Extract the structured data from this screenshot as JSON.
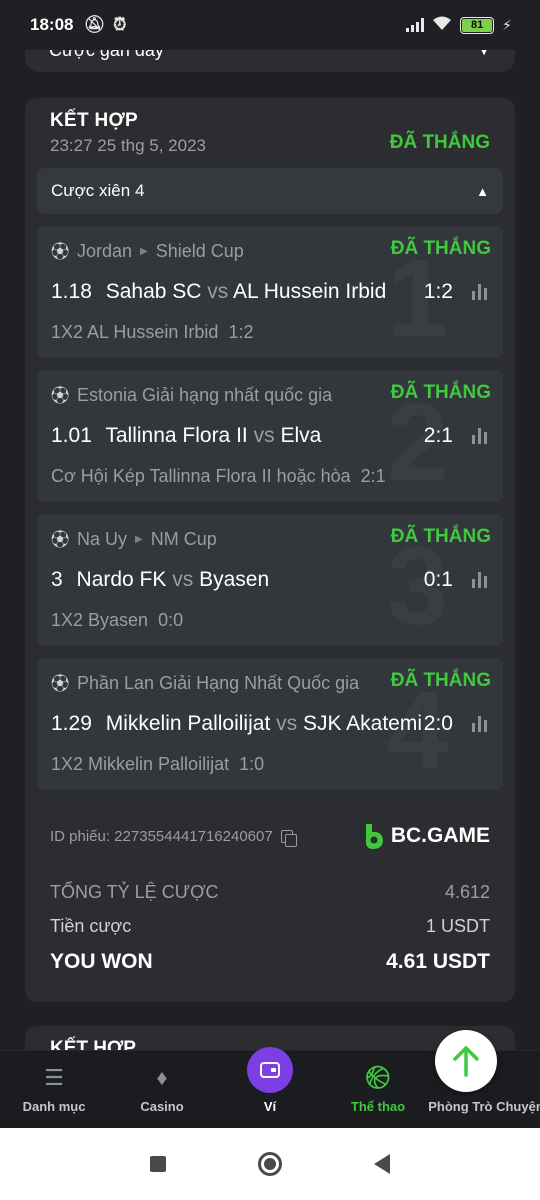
{
  "status": {
    "time": "18:08",
    "battery": "81"
  },
  "recent": {
    "label": "Cược gần đây"
  },
  "bet": {
    "title": "KẾT HỢP",
    "date": "23:27 25 thg 5, 2023",
    "status": "ĐÃ THẮNG",
    "parlay_label": "Cược xiên 4",
    "legs": [
      {
        "number": "1",
        "league": "Jordan",
        "competition": "Shield Cup",
        "status": "ĐÃ THẮNG",
        "odds": "1.18",
        "home": "Sahab SC",
        "vs": "vs",
        "away": "AL Hussein Irbid",
        "score": "1:2",
        "pick": "1X2 AL Hussein Irbid",
        "pick_score": "1:2"
      },
      {
        "number": "2",
        "league": "Estonia Giải hạng nhất quốc gia",
        "competition": "",
        "status": "ĐÃ THẮNG",
        "odds": "1.01",
        "home": "Tallinna Flora II",
        "vs": "vs",
        "away": "Elva",
        "score": "2:1",
        "pick": "Cơ Hội Kép Tallinna Flora II hoặc hòa",
        "pick_score": "2:1"
      },
      {
        "number": "3",
        "league": "Na Uy",
        "competition": "NM Cup",
        "status": "ĐÃ THẮNG",
        "odds": "3",
        "home": "Nardo FK",
        "vs": "vs",
        "away": "Byasen",
        "score": "0:1",
        "pick": "1X2 Byasen",
        "pick_score": "0:0"
      },
      {
        "number": "4",
        "league": "Phần Lan Giải Hạng Nhất Quốc gia",
        "competition": "",
        "status": "ĐÃ THẮNG",
        "odds": "1.29",
        "home": "Mikkelin Palloilijat",
        "vs": "vs",
        "away": "SJK Akatemia",
        "score": "2:0",
        "pick": "1X2 Mikkelin Palloilijat",
        "pick_score": "1:0"
      }
    ],
    "ticket_id": "ID phiếu: 227355444171624060​7",
    "brand": "BC.GAME",
    "total_odds_label": "TỔNG TỶ LỆ CƯỢC",
    "total_odds": "4.612",
    "stake_label": "Tiền cược",
    "stake": "1 USDT",
    "won_label": "YOU WON",
    "won_amount": "4.61 USDT"
  },
  "next_card": {
    "title": "KẾT HỢP"
  },
  "nav": {
    "items": [
      {
        "label": "Danh mục",
        "icon": "menu-icon"
      },
      {
        "label": "Casino",
        "icon": "cards-icon"
      },
      {
        "label": "Ví",
        "icon": "wallet-icon"
      },
      {
        "label": "Thể thao",
        "icon": "basketball-icon"
      },
      {
        "label": "Phòng Trò Chuyện",
        "icon": "chat-icon"
      }
    ]
  },
  "colors": {
    "accent_green": "#3ec93e",
    "wallet_purple": "#7b3fe4",
    "background": "#1e2023",
    "card": "#2b2d31"
  }
}
